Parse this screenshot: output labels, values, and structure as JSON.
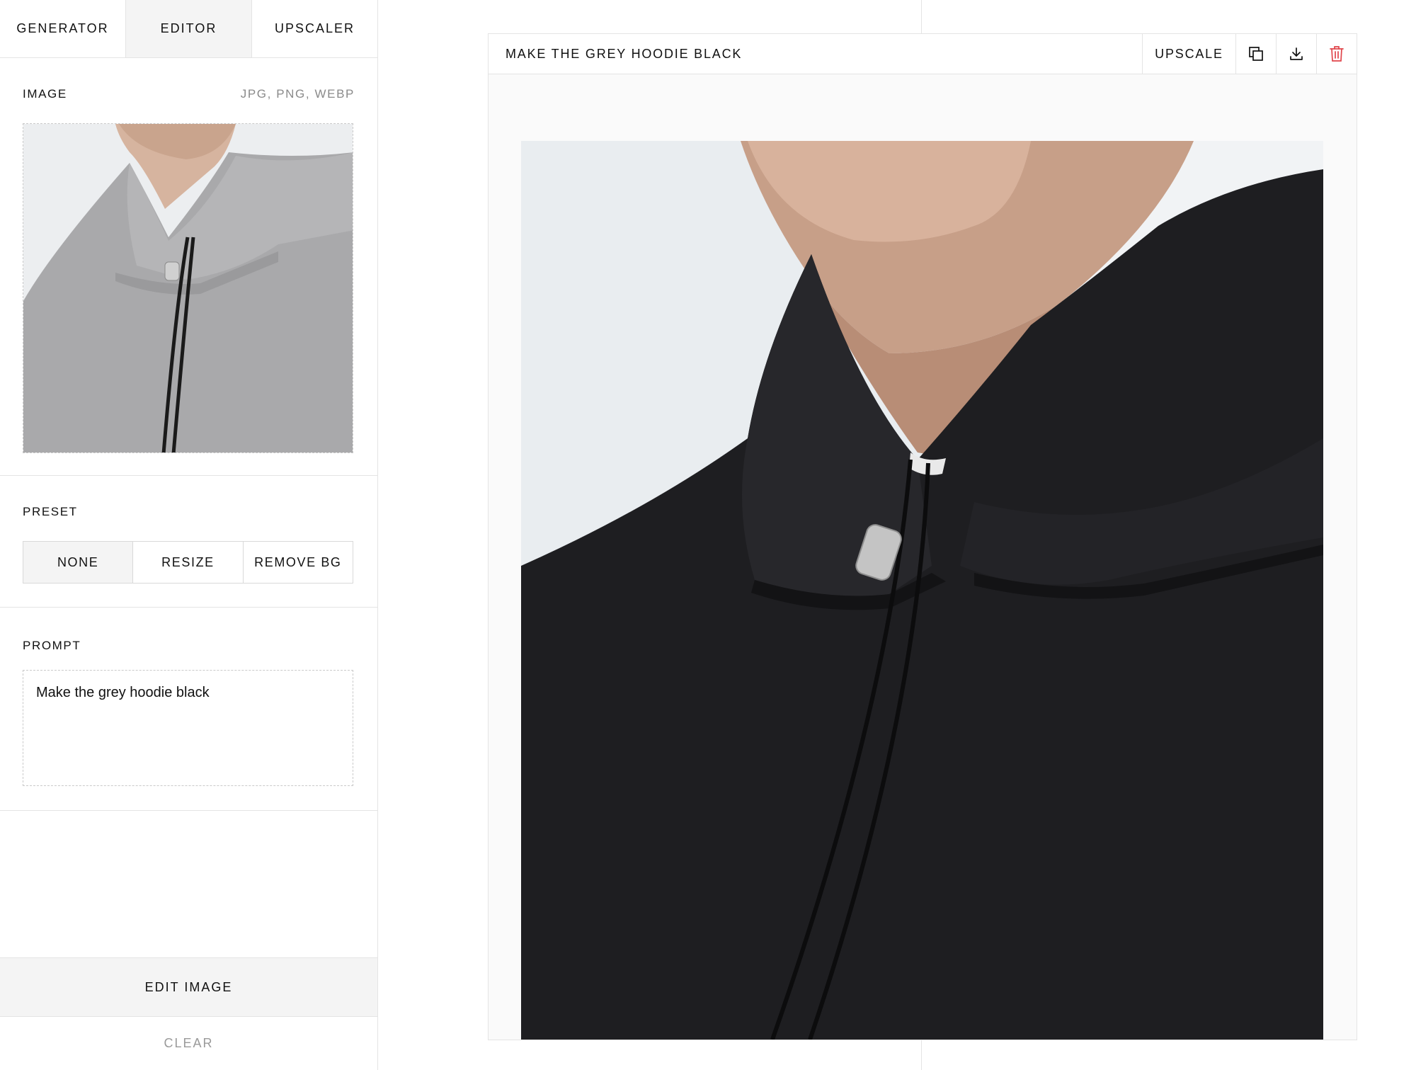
{
  "tabs": [
    {
      "label": "GENERATOR",
      "active": false
    },
    {
      "label": "EDITOR",
      "active": true
    },
    {
      "label": "UPSCALER",
      "active": false
    }
  ],
  "image_section": {
    "label": "IMAGE",
    "formats_hint": "JPG, PNG, WEBP",
    "source_image": "grey-hoodie-photo"
  },
  "preset_section": {
    "label": "PRESET",
    "options": [
      "NONE",
      "RESIZE",
      "REMOVE BG"
    ],
    "selected": "NONE"
  },
  "prompt_section": {
    "label": "PROMPT",
    "value": "Make the grey hoodie black"
  },
  "actions": {
    "edit_label": "EDIT IMAGE",
    "clear_label": "CLEAR"
  },
  "result_card": {
    "title": "MAKE THE GREY HOODIE BLACK",
    "upscale_label": "UPSCALE",
    "icons": [
      "copy-icon",
      "download-icon",
      "trash-icon"
    ],
    "result_image": "black-hoodie-photo"
  },
  "colors": {
    "delete_accent": "#e0454b",
    "active_bg": "#f4f4f4",
    "border": "#e4e4e4"
  }
}
